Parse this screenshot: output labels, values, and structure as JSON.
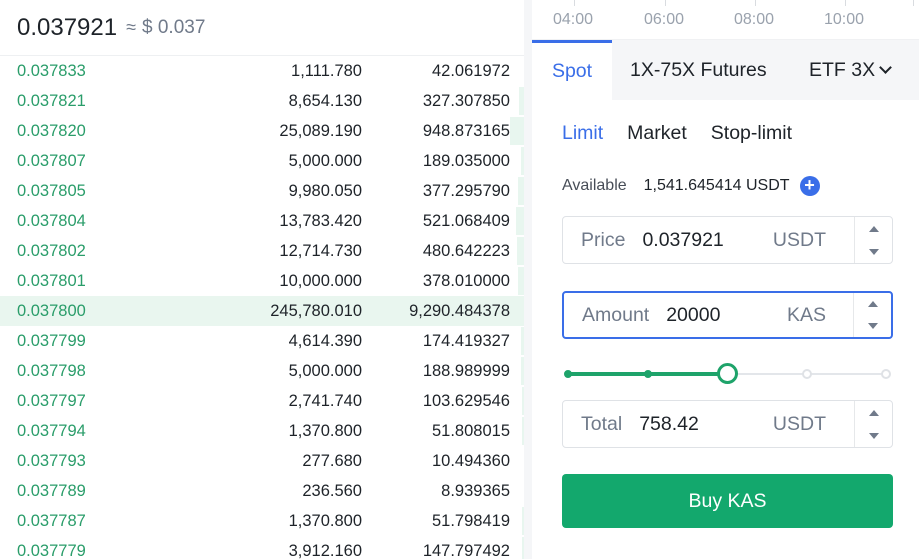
{
  "orderbook": {
    "last_price": "0.037921",
    "approx": "≈",
    "usd_value": "$ 0.037",
    "rows": [
      {
        "price": "0.037833",
        "amount": "1,111.780",
        "total": "42.061972",
        "depth": 0.0
      },
      {
        "price": "0.037821",
        "amount": "8,654.130",
        "total": "327.307850",
        "depth": 0.035
      },
      {
        "price": "0.037820",
        "amount": "25,089.190",
        "total": "948.873165",
        "depth": 0.1
      },
      {
        "price": "0.037807",
        "amount": "5,000.000",
        "total": "189.035000",
        "depth": 0.02
      },
      {
        "price": "0.037805",
        "amount": "9,980.050",
        "total": "377.295790",
        "depth": 0.04
      },
      {
        "price": "0.037804",
        "amount": "13,783.420",
        "total": "521.068409",
        "depth": 0.055
      },
      {
        "price": "0.037802",
        "amount": "12,714.730",
        "total": "480.642223",
        "depth": 0.05
      },
      {
        "price": "0.037801",
        "amount": "10,000.000",
        "total": "378.010000",
        "depth": 0.04
      },
      {
        "price": "0.037800",
        "amount": "245,780.010",
        "total": "9,290.484378",
        "depth": 1.0,
        "highlight": true
      },
      {
        "price": "0.037799",
        "amount": "4,614.390",
        "total": "174.419327",
        "depth": 0.02
      },
      {
        "price": "0.037798",
        "amount": "5,000.000",
        "total": "188.989999",
        "depth": 0.02
      },
      {
        "price": "0.037797",
        "amount": "2,741.740",
        "total": "103.629546",
        "depth": 0.012
      },
      {
        "price": "0.037794",
        "amount": "1,370.800",
        "total": "51.808015",
        "depth": 0.006
      },
      {
        "price": "0.037793",
        "amount": "277.680",
        "total": "10.494360",
        "depth": 0.0
      },
      {
        "price": "0.037789",
        "amount": "236.560",
        "total": "8.939365",
        "depth": 0.0
      },
      {
        "price": "0.037787",
        "amount": "1,370.800",
        "total": "51.798419",
        "depth": 0.006
      },
      {
        "price": "0.037779",
        "amount": "3,912.160",
        "total": "147.797492",
        "depth": 0.016
      }
    ]
  },
  "time_axis": [
    "04:00",
    "06:00",
    "08:00",
    "10:00"
  ],
  "tabs": [
    {
      "label": "Spot",
      "active": true
    },
    {
      "label": "1X-75X Futures",
      "active": false
    },
    {
      "label": "ETF 3X",
      "active": false
    }
  ],
  "order_types": [
    {
      "label": "Limit",
      "active": true
    },
    {
      "label": "Market",
      "active": false
    },
    {
      "label": "Stop-limit",
      "active": false
    }
  ],
  "available": {
    "label": "Available",
    "value": "1,541.645414 USDT"
  },
  "price_field": {
    "label": "Price",
    "value": "0.037921",
    "unit": "USDT"
  },
  "amount_field": {
    "label": "Amount",
    "value": "20000",
    "unit": "KAS"
  },
  "total_field": {
    "label": "Total",
    "value": "758.42",
    "unit": "USDT"
  },
  "slider": {
    "percent": 50,
    "marks": [
      0,
      25,
      50,
      75,
      100
    ]
  },
  "buy_button": {
    "label": "Buy KAS"
  },
  "colors": {
    "accent": "#3a6ee8",
    "buy_green": "#13a86d",
    "bid_text": "#2a9d6a",
    "depth_bg": "#e8f6ef"
  },
  "icons": {
    "available_add": "plus-circle-icon",
    "tab_dropdown": "chevron-down-icon",
    "stepper_up": "caret-up-icon",
    "stepper_down": "caret-down-icon"
  }
}
